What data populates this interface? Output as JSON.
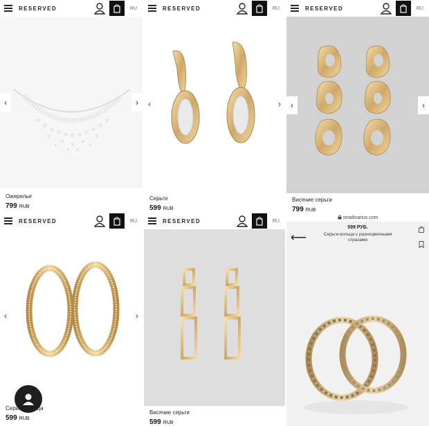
{
  "brand": "RESERVED",
  "lang": "RU",
  "products": [
    {
      "name": "Ожерелье",
      "price": "799",
      "currency": "RUB"
    },
    {
      "name": "Серьги",
      "price": "599",
      "currency": "RUB"
    },
    {
      "name": "Висячие серьги",
      "price": "799",
      "currency": "RUB"
    },
    {
      "name": "Серьги-кольца",
      "price": "599",
      "currency": "RUB"
    },
    {
      "name": "Висячие серьги",
      "price": "599",
      "currency": "RUB"
    }
  ],
  "stradivarius": {
    "url": "stradivarius.com",
    "price": "599 РУБ.",
    "title": "Серьги-кольца с разноцветными стразами"
  },
  "icons": {
    "menu": "hamburger-menu-icon",
    "user": "user-icon",
    "bag": "shopping-bag-icon",
    "prev": "chevron-left-icon",
    "next": "chevron-right-icon",
    "back": "back-arrow-icon",
    "bookmark": "bookmark-icon",
    "lock": "lock-icon",
    "avatar": "profile-avatar-icon"
  }
}
